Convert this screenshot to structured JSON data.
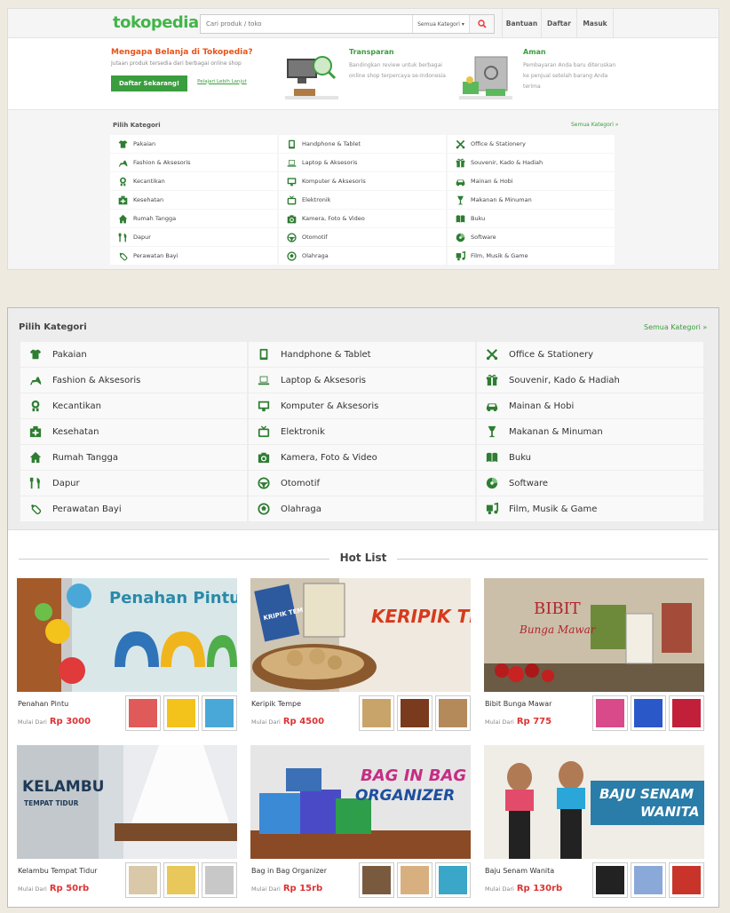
{
  "header": {
    "logo": "tokopedia",
    "search_placeholder": "Cari produk / toko",
    "category_dropdown": "Semua Kategori ▾",
    "nav": [
      "Bantuan",
      "Daftar",
      "Masuk"
    ]
  },
  "promo": {
    "title": "Mengapa Belanja di Tokopedia?",
    "subtitle": "Jutaan produk tersedia dari berbagai online shop",
    "cta": "Daftar Sekarang!",
    "learn_more": "Pelajari Lebih Lanjut",
    "features": [
      {
        "title": "Transparan",
        "desc": "Bandingkan review untuk berbagai online shop terpercaya se-Indonesia"
      },
      {
        "title": "Aman",
        "desc": "Pembayaran Anda baru diteruskan ke penjual setelah barang Anda terima"
      }
    ]
  },
  "categories": {
    "title": "Pilih Kategori",
    "all_link": "Semua Kategori »",
    "items": [
      {
        "label": "Pakaian",
        "icon": "shirt-icon"
      },
      {
        "label": "Handphone & Tablet",
        "icon": "tablet-icon"
      },
      {
        "label": "Office & Stationery",
        "icon": "scissors-icon"
      },
      {
        "label": "Fashion & Aksesoris",
        "icon": "heel-shoe-icon"
      },
      {
        "label": "Laptop & Aksesoris",
        "icon": "laptop-icon"
      },
      {
        "label": "Souvenir, Kado & Hadiah",
        "icon": "gift-icon"
      },
      {
        "label": "Kecantikan",
        "icon": "mirror-icon"
      },
      {
        "label": "Komputer & Aksesoris",
        "icon": "monitor-icon"
      },
      {
        "label": "Mainan & Hobi",
        "icon": "car-icon"
      },
      {
        "label": "Kesehatan",
        "icon": "medkit-icon"
      },
      {
        "label": "Elektronik",
        "icon": "tv-icon"
      },
      {
        "label": "Makanan & Minuman",
        "icon": "glass-icon"
      },
      {
        "label": "Rumah Tangga",
        "icon": "home-icon"
      },
      {
        "label": "Kamera, Foto & Video",
        "icon": "camera-icon"
      },
      {
        "label": "Buku",
        "icon": "book-icon"
      },
      {
        "label": "Dapur",
        "icon": "cutlery-icon"
      },
      {
        "label": "Otomotif",
        "icon": "steering-wheel-icon"
      },
      {
        "label": "Software",
        "icon": "software-disc-icon"
      },
      {
        "label": "Perawatan Bayi",
        "icon": "baby-bottle-icon"
      },
      {
        "label": "Olahraga",
        "icon": "ball-icon"
      },
      {
        "label": "Film, Musik & Game",
        "icon": "film-music-icon"
      }
    ]
  },
  "hotlist": {
    "title": "Hot List",
    "price_prefix": "Mulai Dari",
    "items": [
      {
        "name": "Penahan Pintu",
        "price": "Rp 3000",
        "banner_text": "Penahan Pintu"
      },
      {
        "name": "Keripik Tempe",
        "price": "Rp 4500",
        "banner_text": "KERIPIK TEMPE",
        "bag_label": "KRIPIK TEMPE"
      },
      {
        "name": "Bibit Bunga Mawar",
        "price": "Rp 775",
        "banner_text": "BIBIT",
        "banner_text2": "Bunga Mawar"
      },
      {
        "name": "Kelambu Tempat Tidur",
        "price": "Rp 50rb",
        "banner_text": "KELAMBU",
        "banner_text2": "TEMPAT TIDUR"
      },
      {
        "name": "Bag in Bag Organizer",
        "price": "Rp 15rb",
        "banner_text": "BAG IN BAG",
        "banner_text2": "ORGANIZER"
      },
      {
        "name": "Baju Senam Wanita",
        "price": "Rp 130rb",
        "banner_text": "BAJU SENAM",
        "banner_text2": "WANITA"
      }
    ]
  },
  "colors": {
    "brand_green": "#42b549",
    "accent_orange": "#e8531b",
    "price_red": "#d33333"
  }
}
